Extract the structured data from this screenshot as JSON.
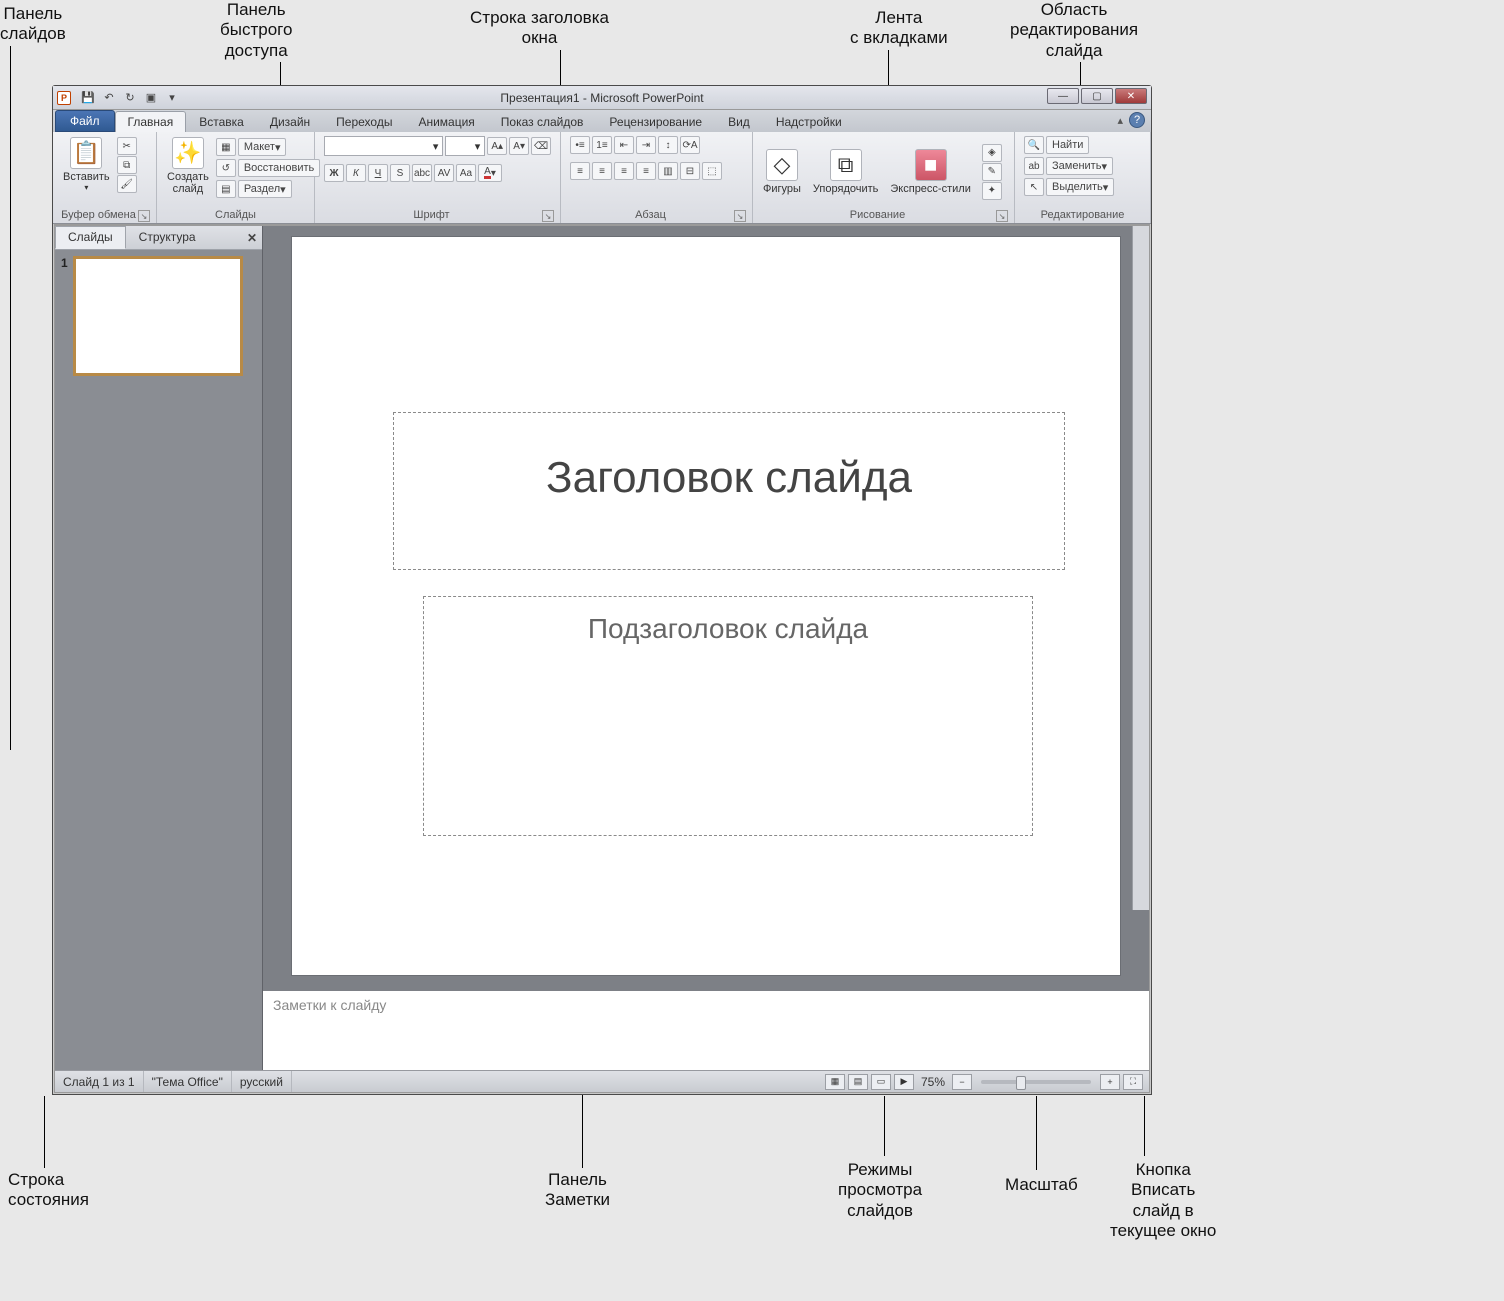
{
  "callouts": {
    "slides_panel": "Панель\nслайдов",
    "qat_panel": "Панель\nбыстрого\nдоступа",
    "titlebar": "Строка заголовка\nокна",
    "ribbon_tabs": "Лента\nс вкладками",
    "edit_area": "Область\nредактирования\nслайда",
    "statusbar": "Строка\nсостояния",
    "notes_panel": "Панель\nЗаметки",
    "view_modes": "Режимы\nпросмотра\nслайдов",
    "zoom": "Масштаб",
    "fit_button": "Кнопка\nВписать\nслайд в\nтекущее окно"
  },
  "title": {
    "doc": "Презентация1",
    "sep": " - ",
    "app": "Microsoft PowerPoint"
  },
  "tabs": {
    "file": "Файл",
    "items": [
      "Главная",
      "Вставка",
      "Дизайн",
      "Переходы",
      "Анимация",
      "Показ слайдов",
      "Рецензирование",
      "Вид",
      "Надстройки"
    ]
  },
  "ribbon": {
    "clipboard": {
      "label": "Буфер обмена",
      "paste": "Вставить"
    },
    "slides": {
      "label": "Слайды",
      "new": "Создать\nслайд",
      "layout": "Макет",
      "reset": "Восстановить",
      "section": "Раздел"
    },
    "font": {
      "label": "Шрифт",
      "bold": "Ж",
      "italic": "К",
      "underline": "Ч",
      "strike": "S",
      "shadow": "abc",
      "spacing": "AV",
      "case": "Aa",
      "clear": "A"
    },
    "para": {
      "label": "Абзац"
    },
    "drawing": {
      "label": "Рисование",
      "shapes": "Фигуры",
      "arrange": "Упорядочить",
      "quick": "Экспресс-стили"
    },
    "editing": {
      "label": "Редактирование",
      "find": "Найти",
      "replace": "Заменить",
      "select": "Выделить"
    }
  },
  "slidepanel": {
    "tab_slides": "Слайды",
    "tab_outline": "Структура",
    "thumb_num": "1"
  },
  "slide": {
    "title_ph": "Заголовок слайда",
    "subtitle_ph": "Подзаголовок слайда"
  },
  "notes": {
    "placeholder": "Заметки к слайду"
  },
  "status": {
    "slide": "Слайд 1 из 1",
    "theme": "\"Тема Office\"",
    "lang": "русский",
    "zoom": "75%"
  }
}
